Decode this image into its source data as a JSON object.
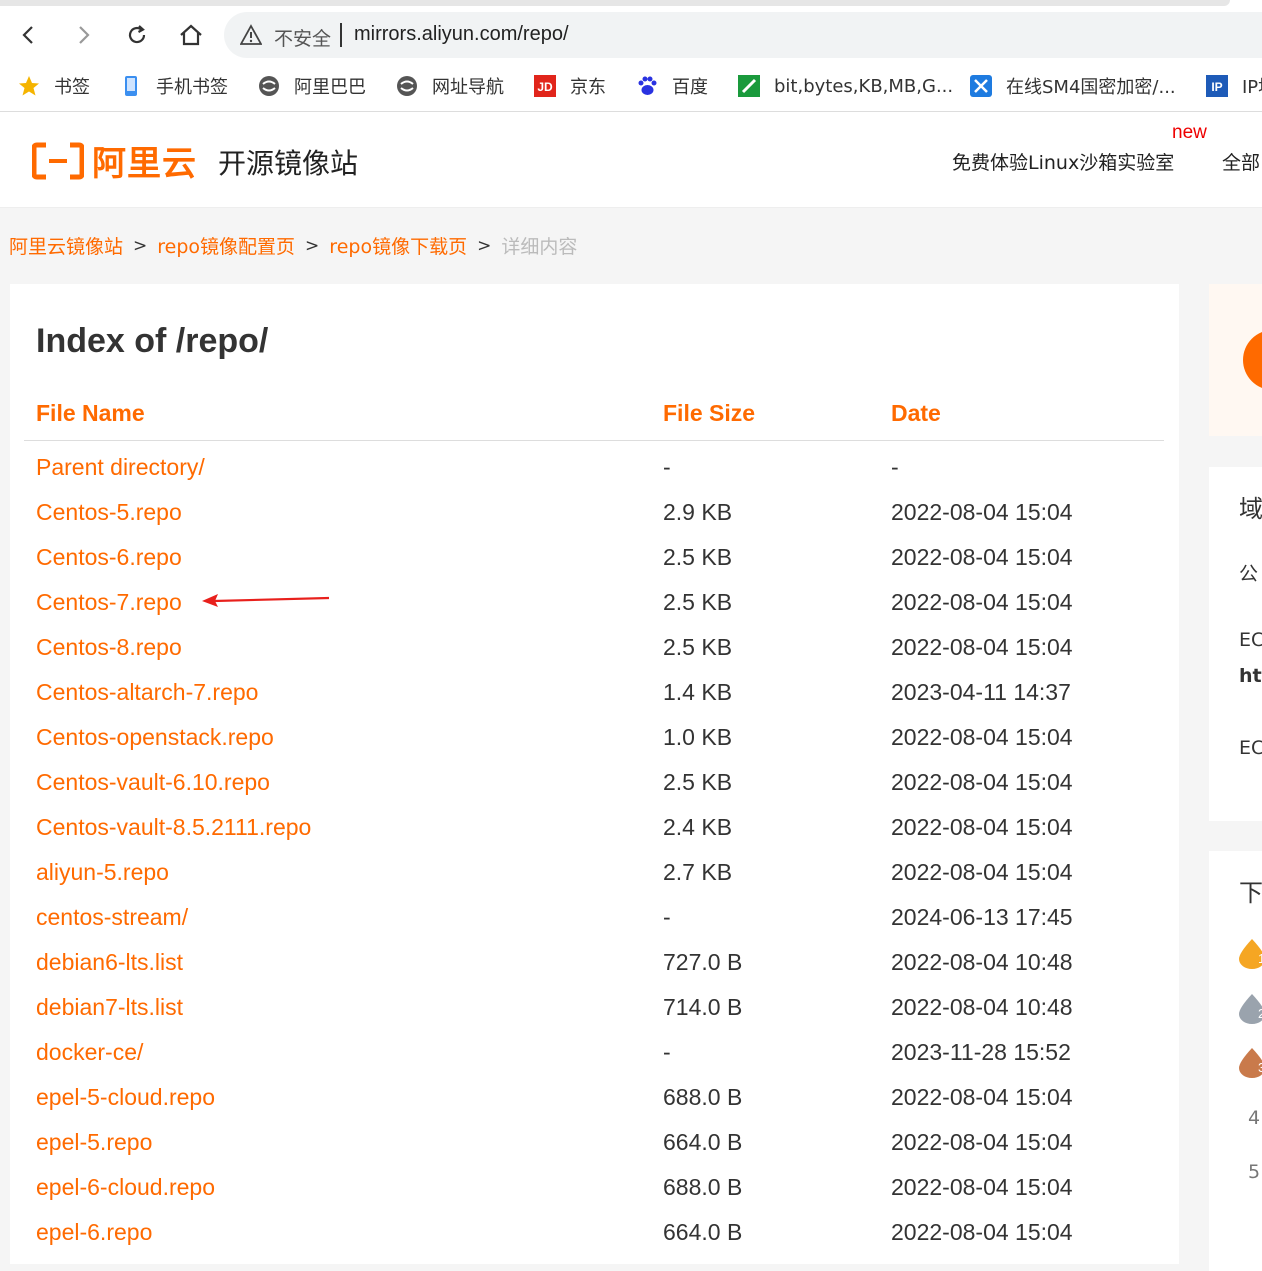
{
  "browser": {
    "insecure_label": "不安全",
    "url": "mirrors.aliyun.com/repo/",
    "bookmarks": [
      {
        "label": "书签",
        "icon": "star-icon"
      },
      {
        "label": "手机书签",
        "icon": "phone-icon"
      },
      {
        "label": "阿里巴巴",
        "icon": "globe-icon"
      },
      {
        "label": "网址导航",
        "icon": "globe-icon"
      },
      {
        "label": "京东",
        "icon": "jd-icon"
      },
      {
        "label": "百度",
        "icon": "baidu-paw-icon"
      },
      {
        "label": "bit,bytes,KB,MB,G...",
        "icon": "green-tool-icon"
      },
      {
        "label": "在线SM4国密加密/...",
        "icon": "tools-icon"
      },
      {
        "label": "IP地",
        "icon": "ip-icon"
      }
    ]
  },
  "header": {
    "logo_text": "阿里云",
    "site_title": "开源镜像站",
    "new_badge": "new",
    "linux_link": "免费体验Linux沙箱实验室",
    "all_link": "全部"
  },
  "breadcrumb": {
    "items": [
      "阿里云镜像站",
      "repo镜像配置页",
      "repo镜像下载页"
    ],
    "current": "详细内容",
    "separator": ">"
  },
  "listing": {
    "title": "Index of /repo/",
    "columns": {
      "name": "File Name",
      "size": "File Size",
      "date": "Date"
    },
    "rows": [
      {
        "name": "Parent directory/",
        "size": "-",
        "date": "-"
      },
      {
        "name": "Centos-5.repo",
        "size": "2.9 KB",
        "date": "2022-08-04 15:04"
      },
      {
        "name": "Centos-6.repo",
        "size": "2.5 KB",
        "date": "2022-08-04 15:04"
      },
      {
        "name": "Centos-7.repo",
        "size": "2.5 KB",
        "date": "2022-08-04 15:04"
      },
      {
        "name": "Centos-8.repo",
        "size": "2.5 KB",
        "date": "2022-08-04 15:04"
      },
      {
        "name": "Centos-altarch-7.repo",
        "size": "1.4 KB",
        "date": "2023-04-11 14:37"
      },
      {
        "name": "Centos-openstack.repo",
        "size": "1.0 KB",
        "date": "2022-08-04 15:04"
      },
      {
        "name": "Centos-vault-6.10.repo",
        "size": "2.5 KB",
        "date": "2022-08-04 15:04"
      },
      {
        "name": "Centos-vault-8.5.2111.repo",
        "size": "2.4 KB",
        "date": "2022-08-04 15:04"
      },
      {
        "name": "aliyun-5.repo",
        "size": "2.7 KB",
        "date": "2022-08-04 15:04"
      },
      {
        "name": "centos-stream/",
        "size": "-",
        "date": "2024-06-13 17:45"
      },
      {
        "name": "debian6-lts.list",
        "size": "727.0 B",
        "date": "2022-08-04 10:48"
      },
      {
        "name": "debian7-lts.list",
        "size": "714.0 B",
        "date": "2022-08-04 10:48"
      },
      {
        "name": "docker-ce/",
        "size": "-",
        "date": "2023-11-28 15:52"
      },
      {
        "name": "epel-5-cloud.repo",
        "size": "688.0 B",
        "date": "2022-08-04 15:04"
      },
      {
        "name": "epel-5.repo",
        "size": "664.0 B",
        "date": "2022-08-04 15:04"
      },
      {
        "name": "epel-6-cloud.repo",
        "size": "688.0 B",
        "date": "2022-08-04 15:04"
      },
      {
        "name": "epel-6.repo",
        "size": "664.0 B",
        "date": "2022-08-04 15:04"
      }
    ]
  },
  "sidebar": {
    "domain_label": "域",
    "public_label": "公",
    "ec1_label": "EC",
    "http_label": "htt",
    "ec2_label": "EC",
    "download_label": "下",
    "rank_4": "4",
    "rank_5": "5"
  },
  "colors": {
    "accent": "#ff6a00",
    "annotation_arrow": "#e8201c"
  }
}
